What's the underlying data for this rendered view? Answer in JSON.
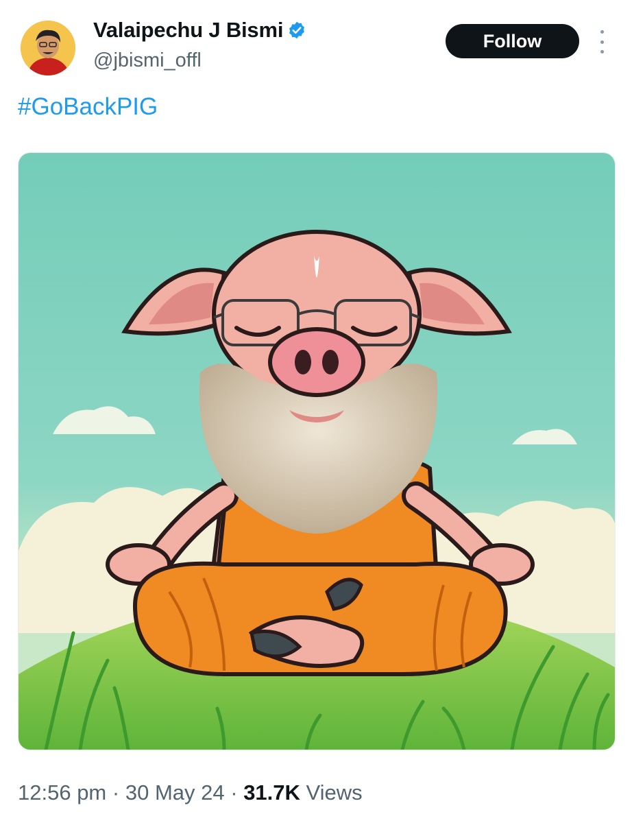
{
  "author": {
    "display_name": "Valaipechu J Bismi",
    "handle": "@jbismi_offl",
    "verified": true
  },
  "follow_button_label": "Follow",
  "tweet": {
    "text": "#GoBackPIG"
  },
  "meta": {
    "time": "12:56 pm",
    "separator": "·",
    "date": "30 May 24",
    "views_count": "31.7K",
    "views_label": "Views"
  },
  "colors": {
    "link": "#1d9bf0",
    "follow_bg": "#0f1419",
    "secondary_text": "#536471",
    "verified": "#1d9bf0"
  },
  "icons": [
    "verified-badge-icon",
    "more-options-icon"
  ]
}
